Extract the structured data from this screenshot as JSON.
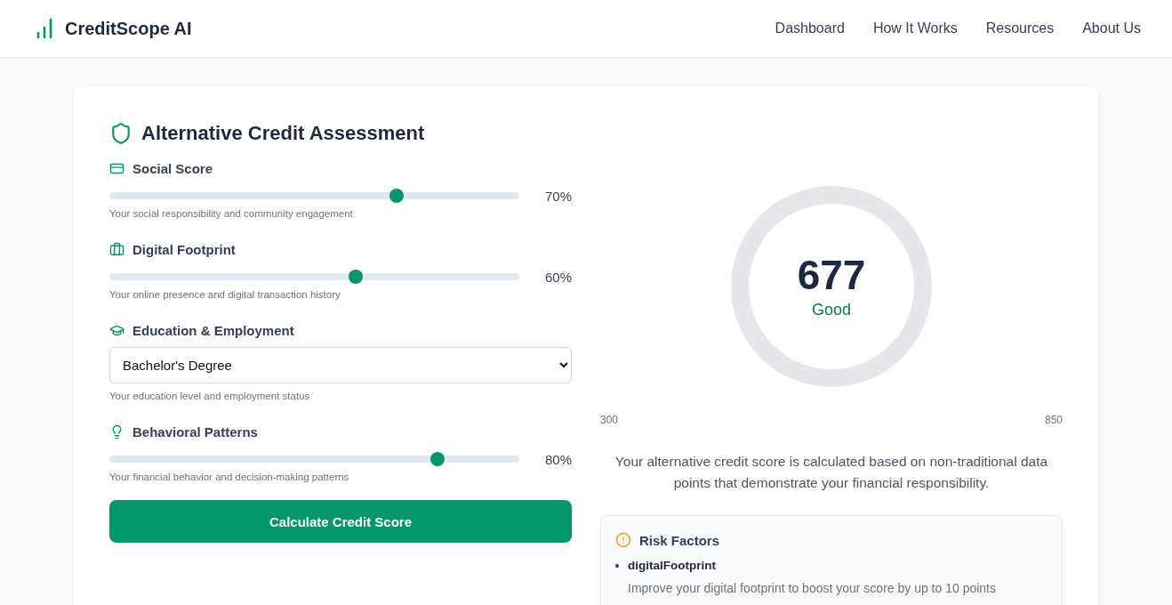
{
  "header": {
    "brand": "CreditScope AI",
    "nav": [
      "Dashboard",
      "How It Works",
      "Resources",
      "About Us"
    ]
  },
  "assessment": {
    "title": "Alternative Credit Assessment",
    "factors": [
      {
        "kind": "slider",
        "label": "Social Score",
        "level": 0.7,
        "reading": "70%",
        "hint": "Your social responsibility and community engagement"
      },
      {
        "kind": "slider",
        "label": "Digital Footprint",
        "level": 0.6,
        "reading": "60%",
        "hint": "Your online presence and digital transaction history"
      },
      {
        "kind": "select",
        "label": "Education & Employment",
        "value": "Bachelor's Degree",
        "hint": "Your education level and employment status"
      },
      {
        "kind": "slider",
        "label": "Behavioral Patterns",
        "level": 0.8,
        "reading": "80%",
        "hint": "Your financial behavior and decision-making patterns"
      }
    ],
    "button": "Calculate Credit Score"
  },
  "score": {
    "value": "677",
    "rating": "Good",
    "min": "300",
    "max": "850",
    "description": "Your alternative credit score is calculated based on non-traditional data points that demonstrate your financial responsibility."
  },
  "risk_factors": {
    "title": "Risk Factors",
    "items": [
      {
        "name": "digitalFootprint",
        "text": "Improve your digital footprint to boost your score by up to 10 points"
      }
    ]
  }
}
